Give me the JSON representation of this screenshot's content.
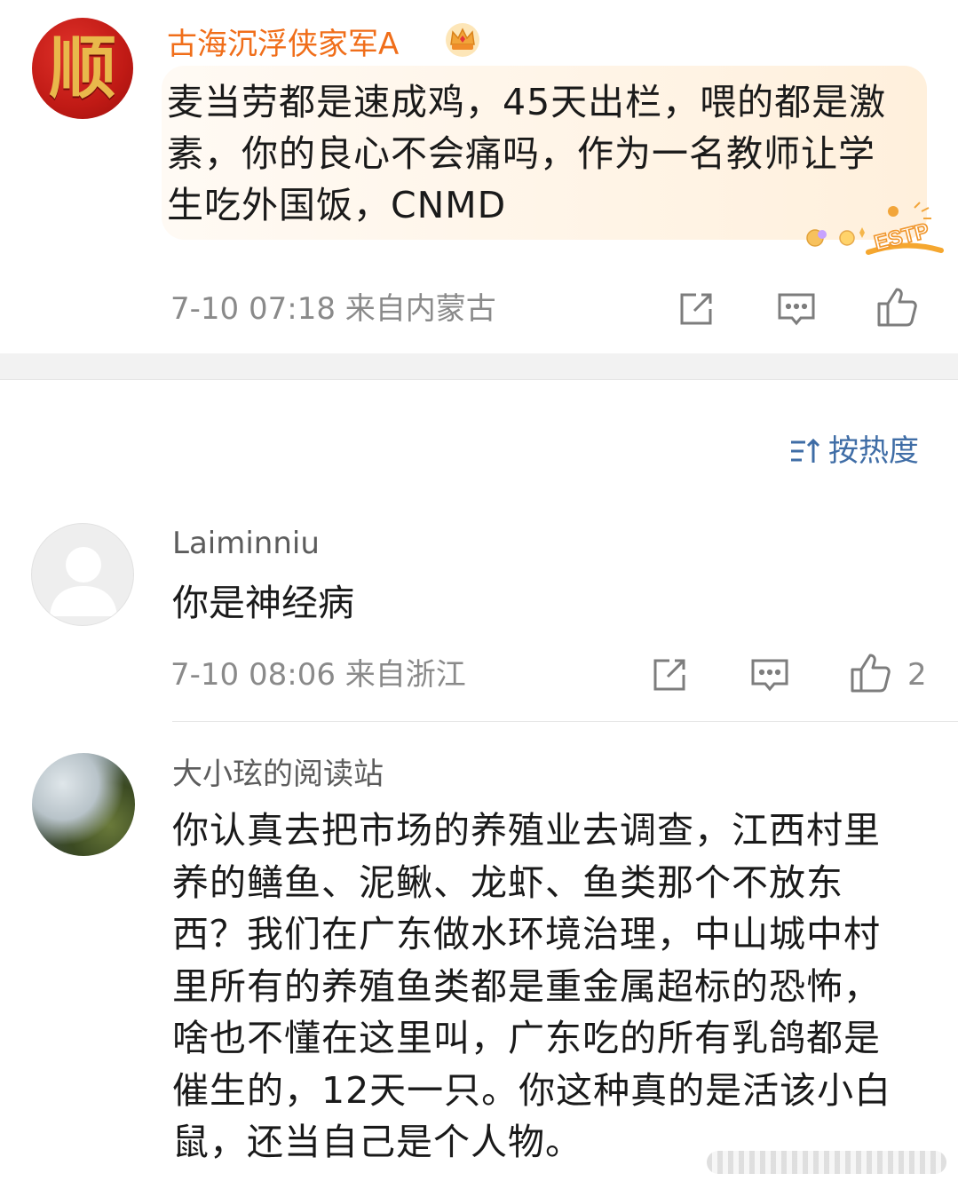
{
  "post": {
    "author": "古海沉浮侠家军A",
    "avatar_glyph": "顺",
    "text": "麦当劳都是速成鸡，45天出栏，喂的都是激素，你的良心不会痛吗，作为一名教师让学生吃外国饭，CNMD",
    "timestamp": "7-10 07:18",
    "location": "来自内蒙古",
    "badge_icon": "crown-icon",
    "sticker_text": "ESTP",
    "author_color": "#f06e1a"
  },
  "sort": {
    "label": "按热度",
    "icon": "sort-icon",
    "color": "#3f6da6"
  },
  "comments": [
    {
      "author": "Laiminniu",
      "text": "你是神经病",
      "timestamp": "7-10 08:06",
      "location": "来自浙江",
      "like_count": "2"
    },
    {
      "author": "大小玹的阅读站",
      "text": "你认真去把市场的养殖业去调查，江西村里养的鳝鱼、泥鳅、龙虾、鱼类那个不放东西？我们在广东做水环境治理，中山城中村里所有的养殖鱼类都是重金属超标的恐怖，啥也不懂在这里叫，广东吃的所有乳鸽都是催生的，12天一只。你这种真的是活该小白鼠，还当自己是个人物。"
    }
  ],
  "icons": {
    "share": "share-icon",
    "comment": "comment-icon",
    "like": "like-icon"
  },
  "colors": {
    "meta_text": "#8a8a8a",
    "bubble": "#fff4e6"
  }
}
